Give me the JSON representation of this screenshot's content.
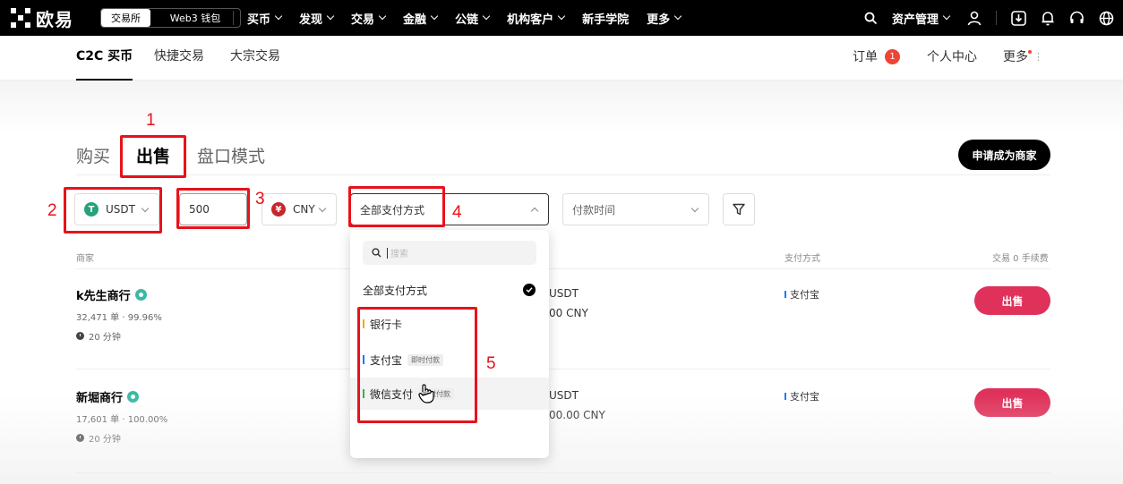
{
  "topnav": {
    "logo_text": "欧易",
    "segment": [
      "交易所",
      "Web3 钱包"
    ],
    "menu": [
      "买币",
      "发现",
      "交易",
      "金融",
      "公链",
      "机构客户",
      "新手学院",
      "更多"
    ],
    "assets_label": "资产管理"
  },
  "subnav": {
    "tabs": [
      "C2C 买币",
      "快捷交易",
      "大宗交易"
    ],
    "orders_label": "订单",
    "orders_badge": "1",
    "profile_label": "个人中心",
    "more_label": "更多"
  },
  "main": {
    "tabs": [
      "购买",
      "出售",
      "盘口模式"
    ],
    "merchant_button": "申请成为商家"
  },
  "filters": {
    "coin": "USDT",
    "amount": "500",
    "fiat": "CNY",
    "fiat_symbol": "¥",
    "payment_method": "全部支付方式",
    "pay_time": "付款时间"
  },
  "table": {
    "col_merchant": "商家",
    "col_payment": "支付方式",
    "col_fee": "交易 0 手续费",
    "rows": [
      {
        "name": "k先生商行",
        "stats": "32,471 单 · 99.96%",
        "time": "20 分钟",
        "limit": "USDT",
        "amount": "00 CNY",
        "payment": "支付宝",
        "action": "出售"
      },
      {
        "name": "新堀商行",
        "stats": "17,601 单 · 100.00%",
        "time": "20 分钟",
        "limit": "USDT",
        "amount": "00.00 CNY",
        "payment": "支付宝",
        "action": "出售"
      }
    ]
  },
  "dropdown": {
    "search_placeholder": "搜索",
    "options": [
      {
        "label": "全部支付方式",
        "selected": true
      },
      {
        "label": "银行卡",
        "color": "#f5a623"
      },
      {
        "label": "支付宝",
        "tag": "即时付款",
        "color": "#1677ff"
      },
      {
        "label": "微信支付",
        "tag": "即时付款",
        "color": "#2db84d"
      }
    ]
  },
  "annotations": [
    "1",
    "2",
    "3",
    "4",
    "5"
  ],
  "colors": {
    "accent": "#e0315a",
    "annotation": "#e8121b",
    "usdt": "#26a17b",
    "cny": "#c8262e"
  }
}
